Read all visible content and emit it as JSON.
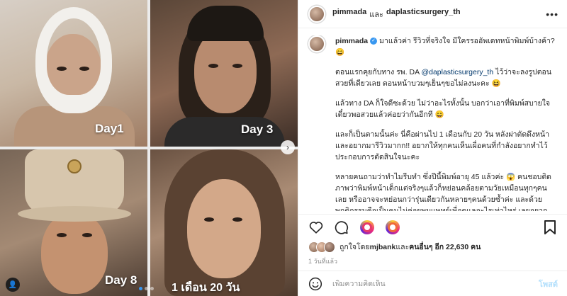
{
  "media": {
    "tiles": [
      {
        "label": "Day1"
      },
      {
        "label": "Day 3"
      },
      {
        "label": "Day 8"
      },
      {
        "label": "1 เดือน 20 วัน"
      }
    ],
    "next_icon": "›",
    "tag_icon": "👤"
  },
  "header": {
    "user1": "pimmada",
    "and": "และ",
    "user2": "daplasticsurgery_th",
    "more_icon": "•••"
  },
  "caption": {
    "username": "pimmada",
    "verified_icon": "✓",
    "line1": "มาแล้วค่า รีวิวที่จริงใจ มีใครรออัพเดทหน้าพิมพ์บ้างค้า? 😄",
    "p2a": "ตอนแรกคุยกับทาง รพ. DA ",
    "p2mention": "@daplasticsurgery_th",
    "p2b": " ไว้ว่าจะลงรูปตอนสวยที่เดียวเลย ตอนหน้าบวมๆเย็นๆขอไม่ลงนะคะ 😆",
    "p3": "แล้วทาง DA ก็ใจดีซะด้วย ไม่ว่าอะไรทั้งนั้น บอกว่าเอาที่พิมพ์สบายใจ เดี๋ยวพอสวยแล้วค่อยว่ากันอีกที 😄",
    "p4": "และก็เป็นตามนั้นค่ะ นี่คือผ่านไป 1 เดือนกับ 20 วัน หลังผ่าตัดดึงหน้า และอยากมารีวิวมากก!! อยากให้ทุกคนเห็นเผื่อคนที่กำลังอยากทำไว้ประกอบการตัดสินใจนะคะ",
    "p5": "หลายคนถามว่าทำไมรีบทำ ซึ่งปีนี้พิมพ์อายุ 45 แล้วค่ะ 😱 คนชอบติดภาพว่าพิมพ์หน้าเด็กแต่จริงๆแล้วก็หย่อนคล้อยตามวัยเหมือนทุกๆคนเลย หรืออาจจะหย่อนกว่ารุ่นเดียวกันหลายๆคนด้วยซ้ำค่ะ และด้วยพฤติกรรมคือเป็นคนไม่ค่อยพบแพทย์เพื่อดูแลอะไรเท่าไหร่ เลยอยากปรึกษาอยู่"
  },
  "likes": {
    "prefix": "ถูกใจโดย ",
    "user": "mjbank",
    "middle": " และ",
    "others": "คนอื่นๆ อีก 22,630 คน"
  },
  "timestamp": "1 วันที่แล้ว",
  "comment_box": {
    "placeholder": "เพิ่มความคิดเห็น",
    "post_label": "โพสต์"
  },
  "colors": {
    "accent": "#3897f0",
    "mention": "#00376b",
    "post_disabled": "#b2dffc"
  }
}
